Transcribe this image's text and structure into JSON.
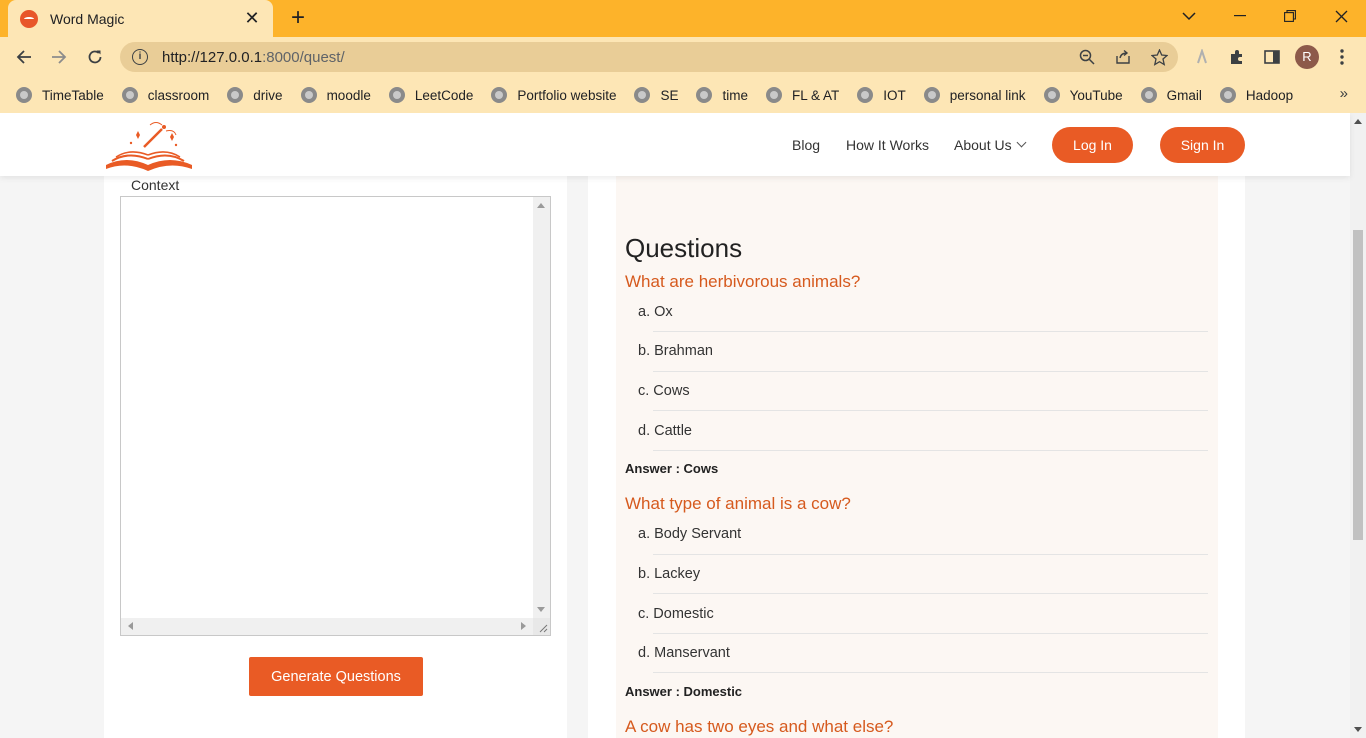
{
  "browser": {
    "tab_title": "Word Magic",
    "tab_close": "✕",
    "new_tab": "+",
    "url_host": "http://127.0.0.1",
    "url_rest": ":8000/quest/",
    "profile_initial": "R",
    "bookmarks": [
      "TimeTable",
      "classroom",
      "drive",
      "moodle",
      "LeetCode",
      "Portfolio website",
      "SE",
      "time",
      "FL & AT",
      "IOT",
      "personal link",
      "YouTube",
      "Gmail",
      "Hadoop"
    ],
    "bookmarks_more": "»"
  },
  "header": {
    "nav": {
      "blog": "Blog",
      "how": "How It Works",
      "about": "About Us"
    },
    "login": "Log In",
    "signin": "Sign In"
  },
  "form": {
    "context_label": "Context",
    "generate_label": "Generate Questions"
  },
  "questions": {
    "heading": "Questions",
    "items": [
      {
        "question": "What are herbivorous animals?",
        "options": [
          "a. Ox",
          "b. Brahman",
          "c. Cows",
          "d. Cattle"
        ],
        "answer": "Answer : Cows"
      },
      {
        "question": "What type of animal is a cow?",
        "options": [
          "a. Body Servant",
          "b. Lackey",
          "c. Domestic",
          "d. Manservant"
        ],
        "answer": "Answer : Domestic"
      },
      {
        "question": "A cow has two eyes and what else?"
      }
    ]
  },
  "colors": {
    "accent": "#e95b25",
    "question": "#d65a1e",
    "chrome": "#fdb32a",
    "chrome_light": "#fde6b5"
  }
}
